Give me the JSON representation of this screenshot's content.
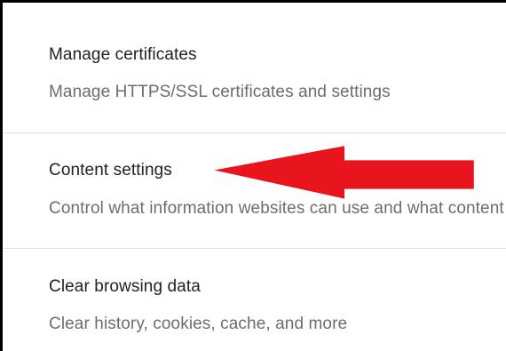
{
  "settings": {
    "items": [
      {
        "title": "Manage certificates",
        "description": "Manage HTTPS/SSL certificates and settings"
      },
      {
        "title": "Content settings",
        "description": "Control what information websites can use and what content they can show you"
      },
      {
        "title": "Clear browsing data",
        "description": "Clear history, cookies, cache, and more"
      }
    ]
  },
  "colors": {
    "arrow": "#e8151f",
    "title_text": "#202124",
    "description_text": "#6d6d6d",
    "divider": "#e0e0e0",
    "frame_border": "#000000"
  }
}
